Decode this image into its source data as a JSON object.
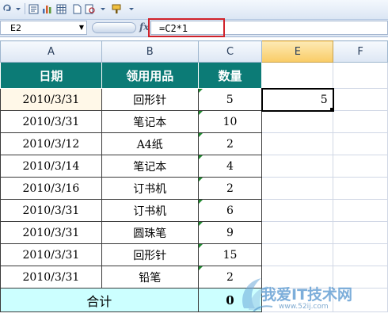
{
  "namebox": {
    "cell_ref": "E2"
  },
  "formula_bar": {
    "formula": "=C2*1"
  },
  "columns": [
    "A",
    "B",
    "C",
    "E",
    "F"
  ],
  "header": {
    "date": "日期",
    "item": "领用用品",
    "qty": "数量"
  },
  "rows": [
    {
      "date": "2010/3/31",
      "item": "回形针",
      "qty": "5"
    },
    {
      "date": "2010/3/31",
      "item": "笔记本",
      "qty": "10"
    },
    {
      "date": "2010/3/12",
      "item": "A4纸",
      "qty": "2"
    },
    {
      "date": "2010/3/14",
      "item": "笔记本",
      "qty": "4"
    },
    {
      "date": "2010/3/16",
      "item": "订书机",
      "qty": "2"
    },
    {
      "date": "2010/3/31",
      "item": "订书机",
      "qty": "6"
    },
    {
      "date": "2010/3/31",
      "item": "圆珠笔",
      "qty": "9"
    },
    {
      "date": "2010/3/31",
      "item": "回形针",
      "qty": "15"
    },
    {
      "date": "2010/3/31",
      "item": "铅笔",
      "qty": "2"
    }
  ],
  "total": {
    "label": "合计",
    "value": "0"
  },
  "selected_cell_value": "5",
  "watermark": {
    "text": "我爱IT技术网",
    "url": "www.52ij.com"
  },
  "colors": {
    "header_teal": "#0c7b76",
    "total_fill": "#ccffff",
    "highlight": "#d0222a"
  }
}
